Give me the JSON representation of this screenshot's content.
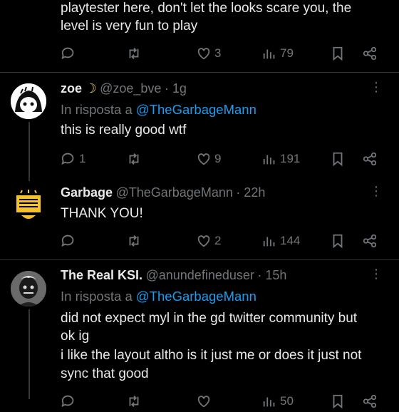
{
  "tweets": [
    {
      "text_lines": [
        "playtester here, don't let the looks scare you, the",
        "level is very fun to play"
      ],
      "actions": {
        "reply": "",
        "retweet": "",
        "like": "3",
        "views": "79"
      }
    },
    {
      "display_name": "zoe",
      "name_emoji": "☽",
      "handle": "@zoe_bve",
      "time": "· 1g",
      "reply_prefix": "In risposta a",
      "reply_to": "@TheGarbageMann",
      "text_lines": [
        "this is really good wtf"
      ],
      "actions": {
        "reply": "1",
        "retweet": "",
        "like": "9",
        "views": "191"
      }
    },
    {
      "display_name": "Garbage",
      "handle": "@TheGarbageMann",
      "time": "· 22h",
      "text_lines": [
        "THANK YOU!"
      ],
      "actions": {
        "reply": "",
        "retweet": "",
        "like": "2",
        "views": "144"
      }
    },
    {
      "display_name": "The Real KSI.",
      "handle": "@anundefineduser",
      "time": "· 15h",
      "reply_prefix": "In risposta a",
      "reply_to": "@TheGarbageMann",
      "text_lines": [
        "did not expect myl in the gd twitter community but",
        "ok ig",
        "i like the layout altho is it just me or does it just not",
        "sync that good"
      ],
      "actions": {
        "reply": "",
        "retweet": "",
        "like": "",
        "views": "50"
      }
    }
  ],
  "more_label": "⋮",
  "colors": {
    "background": "#000000",
    "text": "#e7e9ea",
    "muted": "#71767b",
    "link": "#1d9bf0",
    "divider": "#2f3336"
  }
}
